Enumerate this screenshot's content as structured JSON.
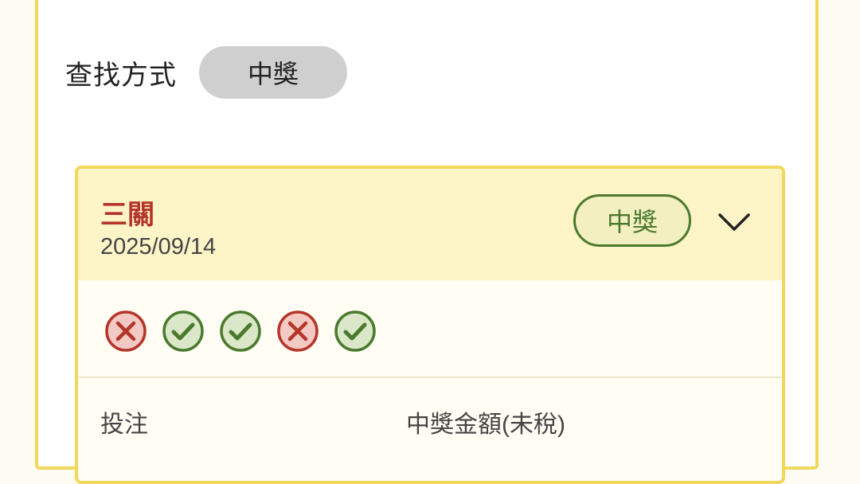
{
  "search": {
    "label": "查找方式",
    "mode": "中獎"
  },
  "result": {
    "game": "三關",
    "date": "2025/09/14",
    "status": "中獎",
    "marks": [
      "cross",
      "check",
      "check",
      "cross",
      "check"
    ],
    "columns": [
      "投注",
      "中獎金額(未稅)"
    ]
  },
  "colors": {
    "accent_border": "#f1d85a",
    "header_bg": "#fdf4c8",
    "game_name": "#b5352a",
    "win_green": "#4a7a2e",
    "lose_red": "#b5352a"
  }
}
